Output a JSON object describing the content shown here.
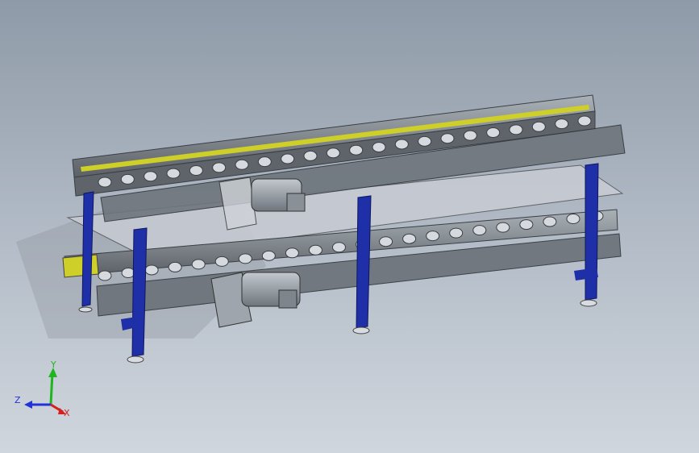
{
  "view": {
    "background_top": "#8f9aa8",
    "background_bottom": "#d0d6dd"
  },
  "model": {
    "frame_color": "#1f2fa8",
    "rail_color": "#7f868c",
    "accent_color": "#cfcf2a",
    "plate_color": "#c8ccd4",
    "motor_color": "#9aa1a8"
  },
  "triad": {
    "y_label": "Y",
    "z_label": "Z",
    "x_label": "X",
    "y_color": "#1fb51f",
    "z_color": "#2232d6",
    "x_color": "#d42020"
  }
}
